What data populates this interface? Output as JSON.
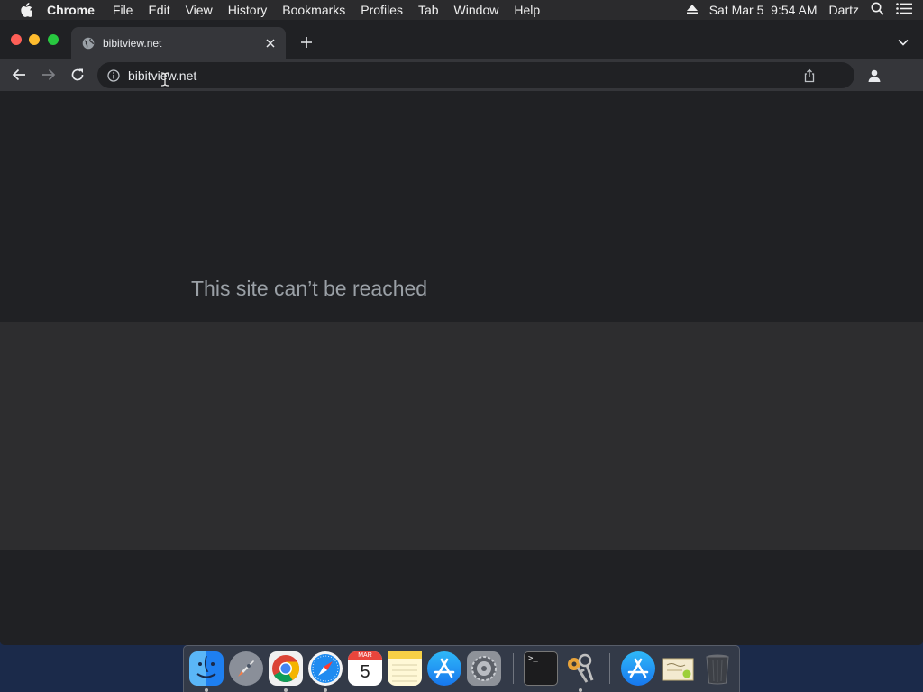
{
  "menubar": {
    "app": "Chrome",
    "items": [
      "File",
      "Edit",
      "View",
      "History",
      "Bookmarks",
      "Profiles",
      "Tab",
      "Window",
      "Help"
    ],
    "datetime": "Sat Mar 5  9:54 AM",
    "user": "Dartz"
  },
  "browser": {
    "tab_title": "bibitview.net",
    "url": "bibitview.net"
  },
  "page": {
    "heading": "This site can’t be reached"
  },
  "dock": {
    "calendar_month": "MAR",
    "calendar_day": "5",
    "terminal_prompt": ">_"
  },
  "colors": {
    "window_bg": "#202124",
    "toolbar_bg": "#35363a",
    "accent_close": "#fe5f57",
    "accent_min": "#febc2e",
    "accent_max": "#28c840"
  }
}
